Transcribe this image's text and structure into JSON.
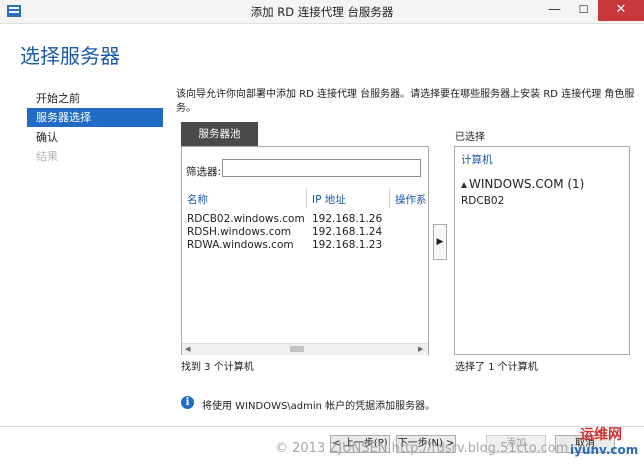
{
  "window": {
    "title": "添加 RD 连接代理 台服务器",
    "minimize": "—",
    "maximize": "☐",
    "close": "✕"
  },
  "page": {
    "title": "选择服务器"
  },
  "nav": {
    "items": [
      {
        "label": "开始之前"
      },
      {
        "label": "服务器选择"
      },
      {
        "label": "确认"
      },
      {
        "label": "结果"
      }
    ]
  },
  "description": "该向导允许你向部署中添加 RD 连接代理 台服务器。请选择要在哪些服务器上安装 RD 连接代理 角色服务。",
  "pool": {
    "tab_label": "服务器池",
    "filter_label": "筛选器:",
    "filter_value": "",
    "columns": [
      "名称",
      "IP 地址",
      "操作系"
    ],
    "rows": [
      {
        "name": "RDCB02.windows.com",
        "ip": "192.168.1.26"
      },
      {
        "name": "RDSH.windows.com",
        "ip": "192.168.1.24"
      },
      {
        "name": "RDWA.windows.com",
        "ip": "192.168.1.23"
      }
    ],
    "found_text": "找到 3 个计算机"
  },
  "add_arrow": "▶",
  "selected": {
    "label": "已选择",
    "column": "计算机",
    "group": "WINDOWS.COM (1)",
    "items": [
      "RDCB02"
    ],
    "count_text": "选择了 1 个计算机"
  },
  "info": {
    "text": "将使用 WINDOWS\\admin 帐户的凭据添加服务器。"
  },
  "buttons": {
    "prev": "< 上一步(P)",
    "next": "下一步(N) >",
    "add": "添加",
    "cancel": "取消"
  },
  "watermark": "© 2013 ZJUNSEN http://rdsrv.blog.51cto.com",
  "logo": {
    "cn": "运维网",
    "en": "iyunv.com"
  }
}
